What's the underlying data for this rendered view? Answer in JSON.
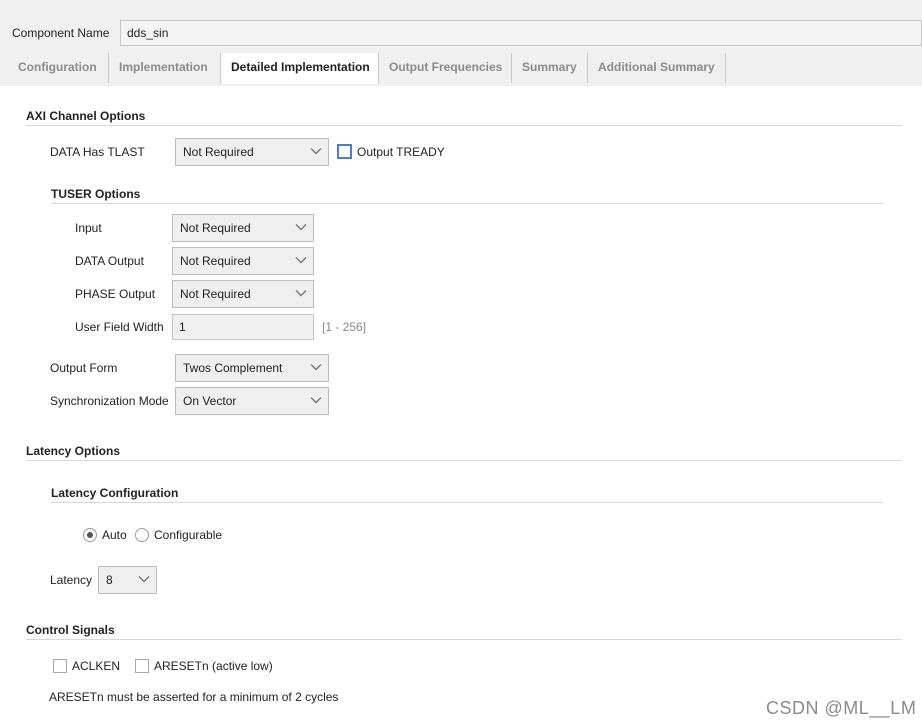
{
  "header": {
    "component_name_label": "Component Name",
    "component_name_value": "dds_sin"
  },
  "tabs": [
    {
      "label": "Configuration",
      "active": false
    },
    {
      "label": "Implementation",
      "active": false
    },
    {
      "label": "Detailed Implementation",
      "active": true
    },
    {
      "label": "Output Frequencies",
      "active": false
    },
    {
      "label": "Summary",
      "active": false
    },
    {
      "label": "Additional Summary",
      "active": false
    }
  ],
  "axi": {
    "title": "AXI Channel Options",
    "data_has_tlast_label": "DATA Has TLAST",
    "data_has_tlast_value": "Not Required",
    "output_tready_label": "Output TREADY",
    "output_tready_checked": false,
    "tuser": {
      "title": "TUSER Options",
      "input_label": "Input",
      "input_value": "Not Required",
      "data_output_label": "DATA Output",
      "data_output_value": "Not Required",
      "phase_output_label": "PHASE Output",
      "phase_output_value": "Not Required",
      "user_field_width_label": "User Field Width",
      "user_field_width_value": "1",
      "user_field_width_range": "[1 - 256]"
    },
    "output_form_label": "Output Form",
    "output_form_value": "Twos Complement",
    "sync_mode_label": "Synchronization Mode",
    "sync_mode_value": "On Vector"
  },
  "latency": {
    "title": "Latency Options",
    "config_title": "Latency Configuration",
    "auto_label": "Auto",
    "configurable_label": "Configurable",
    "selected": "Auto",
    "latency_label": "Latency",
    "latency_value": "8"
  },
  "control": {
    "title": "Control Signals",
    "aclken_label": "ACLKEN",
    "aclken_checked": false,
    "aresetn_label": "ARESETn (active low)",
    "aresetn_checked": false,
    "note": "ARESETn must be asserted for a minimum of 2 cycles"
  },
  "watermark": "CSDN @ML__LM",
  "colors": {
    "tab_inactive_text": "#8a8a8a",
    "checkbox_focus": "#4a7fc1",
    "toolbar_bg": "#f0f0f0"
  }
}
